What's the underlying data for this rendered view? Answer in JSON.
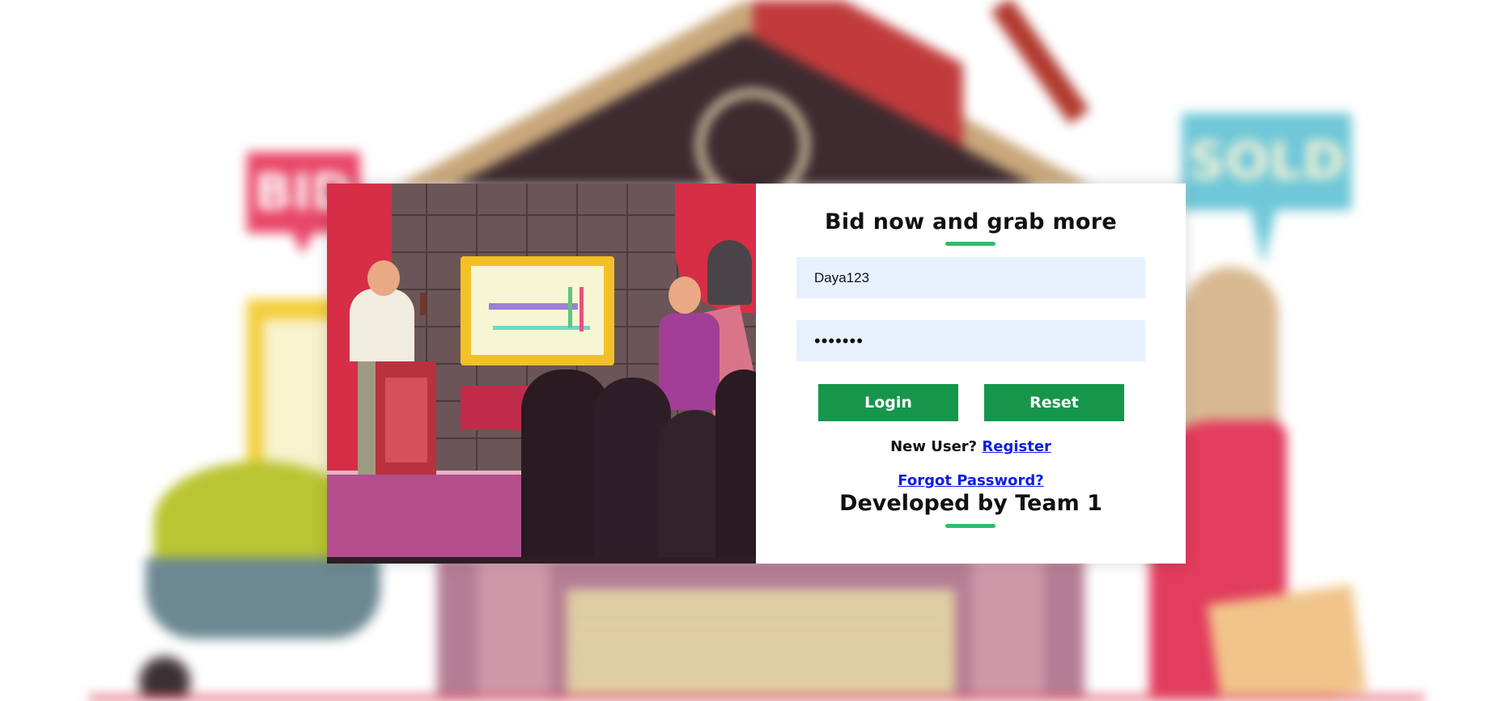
{
  "background": {
    "sign_bid": "BID",
    "sign_sold": "SOLD"
  },
  "login": {
    "heading": "Bid now and grab more",
    "username_value": "Daya123",
    "password_value": "•••••••",
    "login_label": "Login",
    "reset_label": "Reset",
    "new_user_text": "New User?",
    "register_link": "Register",
    "forgot_link": "Forgot Password?",
    "footer": "Developed by Team 1"
  },
  "colors": {
    "accent_green": "#16964b",
    "underline_green": "#2ebd6b",
    "input_bg": "#e8f0fe",
    "link_blue": "#0b1fe0"
  }
}
